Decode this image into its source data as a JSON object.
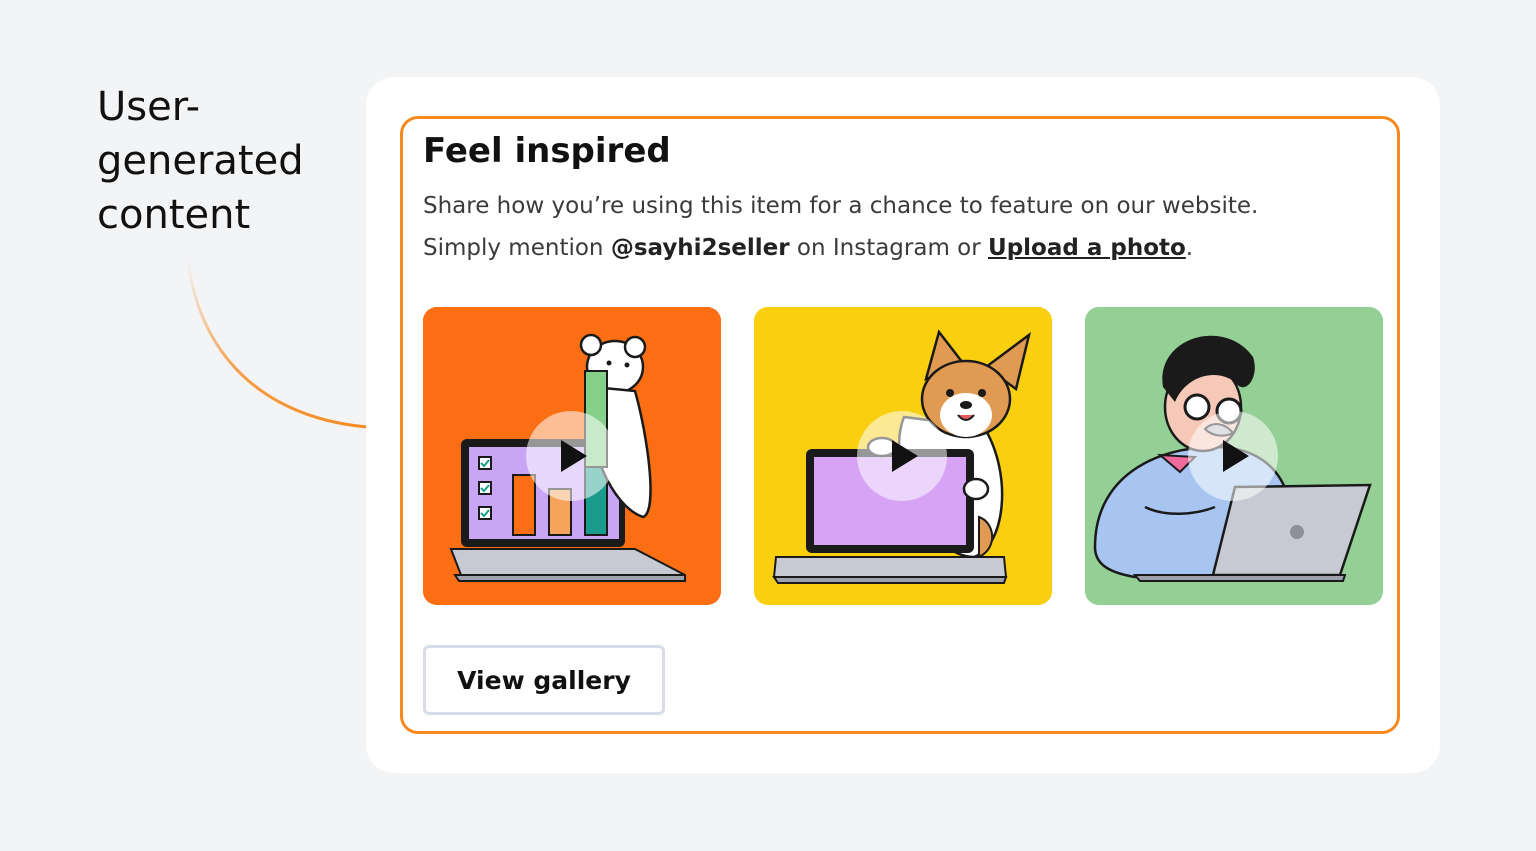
{
  "annotation": {
    "label": "User-\ngenerated\ncontent"
  },
  "section": {
    "title": "Feel inspired",
    "description_line1": "Share how you’re using this item for a chance to feature on our website.",
    "line2_prefix": "Simply mention ",
    "handle": "@sayhi2seller",
    "line2_middle": " on Instagram or ",
    "upload_link": "Upload a photo",
    "line2_suffix": "."
  },
  "videos": [
    {
      "icon": "cat-with-laptop-chart-illustration",
      "bg": "#fb6e14"
    },
    {
      "icon": "corgi-with-laptop-illustration",
      "bg": "#f9cf10"
    },
    {
      "icon": "man-with-laptop-illustration",
      "bg": "#94cf95"
    }
  ],
  "buttons": {
    "view_gallery": "View gallery"
  },
  "colors": {
    "accent_frame": "#f5891d",
    "background": "#f3f4f6",
    "card": "#ffffff"
  }
}
